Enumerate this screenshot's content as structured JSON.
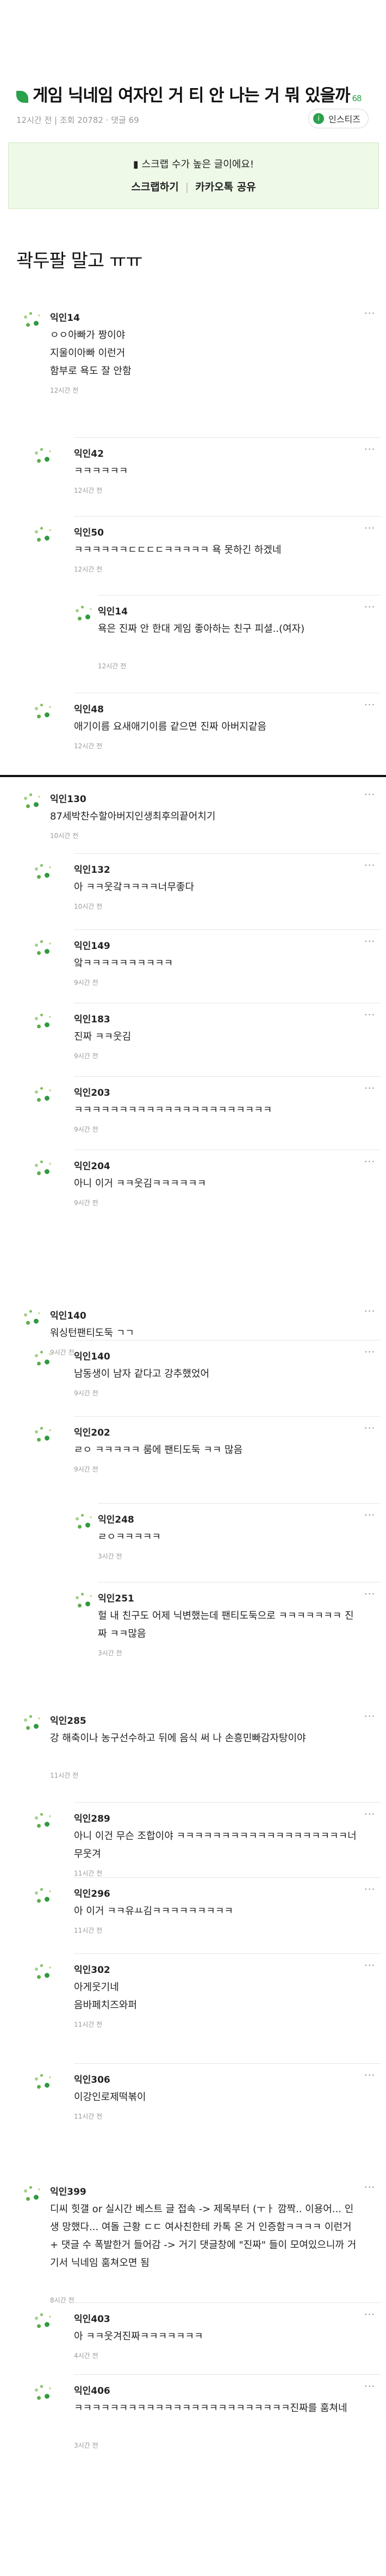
{
  "post": {
    "title": "게임 닉네임 여자인 거 티 안 나는 거 뭐 있을까",
    "comment_count": "68",
    "meta": "12시간 전  |  조회 20782 · 댓글 69",
    "share_label": "인스티즈",
    "share_icon": "instiz-logo-icon",
    "scrap_notice": "스크랩 수가 높은 글이에요!",
    "scrap_button": "스크랩하기",
    "kakao_button": "카카오톡 공유",
    "body": "곽두팔 말고 ㅠㅠ",
    "accent_color": "#2aa14c"
  },
  "comments": [
    {
      "name": "익인14",
      "text": "ㅇㅇ아빠가 짱이야\n지울이아빠 이런거\n함부로 욕도 잘 안함",
      "time": "12시간 전"
    },
    {
      "name": "익인42",
      "text": "ㅋㅋㅋㅋㅋㅋ",
      "time": "12시간 전"
    },
    {
      "name": "익인50",
      "text": "ㅋㅋㅋㅋㅋㅋㄷㄷㄷㄷㅋㅋㅋㅋㅋ 욕 못하긴 하겠네",
      "time": "12시간 전"
    },
    {
      "name": "익인14",
      "text": "욕은 진짜 안 한대 게임 좋아하는 친구 피셜..(여자)",
      "time": "12시간 전"
    },
    {
      "name": "익인48",
      "text": "애기이름 요새애기이름 같으면 진짜 아버지같음",
      "time": "12시간 전"
    },
    {
      "name": "익인130",
      "text": "87세박찬수할아버지인생최후의끝어치기",
      "time": "10시간 전"
    },
    {
      "name": "익인132",
      "text": "아 ㅋㅋ웃갘ㅋㅋㅋㅋ너무좋다",
      "time": "10시간 전"
    },
    {
      "name": "익인149",
      "text": "앜ㅋㅋㅋㅋㅋㅋㅋㅋㅋㅋ",
      "time": "9시간 전"
    },
    {
      "name": "익인183",
      "text": "진짜 ㅋㅋ웃김",
      "time": "9시간 전"
    },
    {
      "name": "익인203",
      "text": "ㅋㅋㅋㅋㅋㅋㅋㅋㅋㅋㅋㅋㅋㅋㅋㅋㅋㅋㅋㅋㅋㅋ",
      "time": "9시간 전"
    },
    {
      "name": "익인204",
      "text": "아니 이거 ㅋㅋ웃김ㅋㅋㅋㅋㅋㅋ",
      "time": "9시간 전"
    },
    {
      "name": "익인140",
      "text": "워싱턴팬티도둑 ㄱㄱ",
      "time": "9시간 전"
    },
    {
      "name": "익인140",
      "text": "남동생이 남자 같다고 강추했었어",
      "time": "9시간 전"
    },
    {
      "name": "익인202",
      "text": "ㄹㅇ ㅋㅋㅋㅋㅋ 룸에 팬티도둑 ㅋㅋ 많음",
      "time": "9시간 전"
    },
    {
      "name": "익인248",
      "text": "ㄹㅇㅋㅋㅋㅋㅋ",
      "time": "3시간 전"
    },
    {
      "name": "익인251",
      "text": "헐 내 친구도 어제 닉변했는데 팬티도둑으로 ㅋㅋㅋㅋㅋㅋㅋ 진짜 ㅋㅋ많음",
      "time": "3시간 전"
    },
    {
      "name": "익인285",
      "text": "강 해축이나 농구선수하고 뒤에 음식 써 나 손흥민빠감자탕이야",
      "time": "11시간 전"
    },
    {
      "name": "익인289",
      "text": "아니 이건 무슨 조합이야 ㅋㅋㅋㅋㅋㅋㅋㅋㅋㅋㅋㅋㅋㅋㅋㅋㅋㅋㅋ너무웃겨",
      "time": "11시간 전"
    },
    {
      "name": "익인296",
      "text": "아 이거 ㅋㅋ유ㅛ김ㅋㅋㅋㅋㅋㅋㅋㅋㅋ",
      "time": "11시간 전"
    },
    {
      "name": "익인302",
      "text": "아게웃기네\n음바페치즈와퍼",
      "time": "11시간 전"
    },
    {
      "name": "익인306",
      "text": "이강인로제떡볶이",
      "time": "11시간 전"
    },
    {
      "name": "익인399",
      "text": "디씨 힛갤 or 실시간 베스트 글 접속 -> 제목부터 (ㅜㅏ 깜짝.. 이용어... 인생 망했다... 여돌 근황 ㄷㄷ 여사친한테 카톡 온 거 인증함ㅋㅋㅋㅋ 이런거 + 댓글 수 폭발한거 들어감 -> 거기 댓글창에 \"진짜\" 들이 모여있으니까 거기서 닉네임 훔쳐오면 됨",
      "time": "8시간 전"
    },
    {
      "name": "익인403",
      "text": "아 ㅋㅋ웃겨진짜ㅋㅋㅋㅋㅋㅋㅋ",
      "time": "4시간 전"
    },
    {
      "name": "익인406",
      "text": "ㅋㅋㅋㅋㅋㅋㅋㅋㅋㅋㅋㅋㅋㅋㅋㅋㅋㅋㅋㅋㅋㅋㅋㅋ진짜를 훔쳐네",
      "time": "3시간 전"
    }
  ]
}
